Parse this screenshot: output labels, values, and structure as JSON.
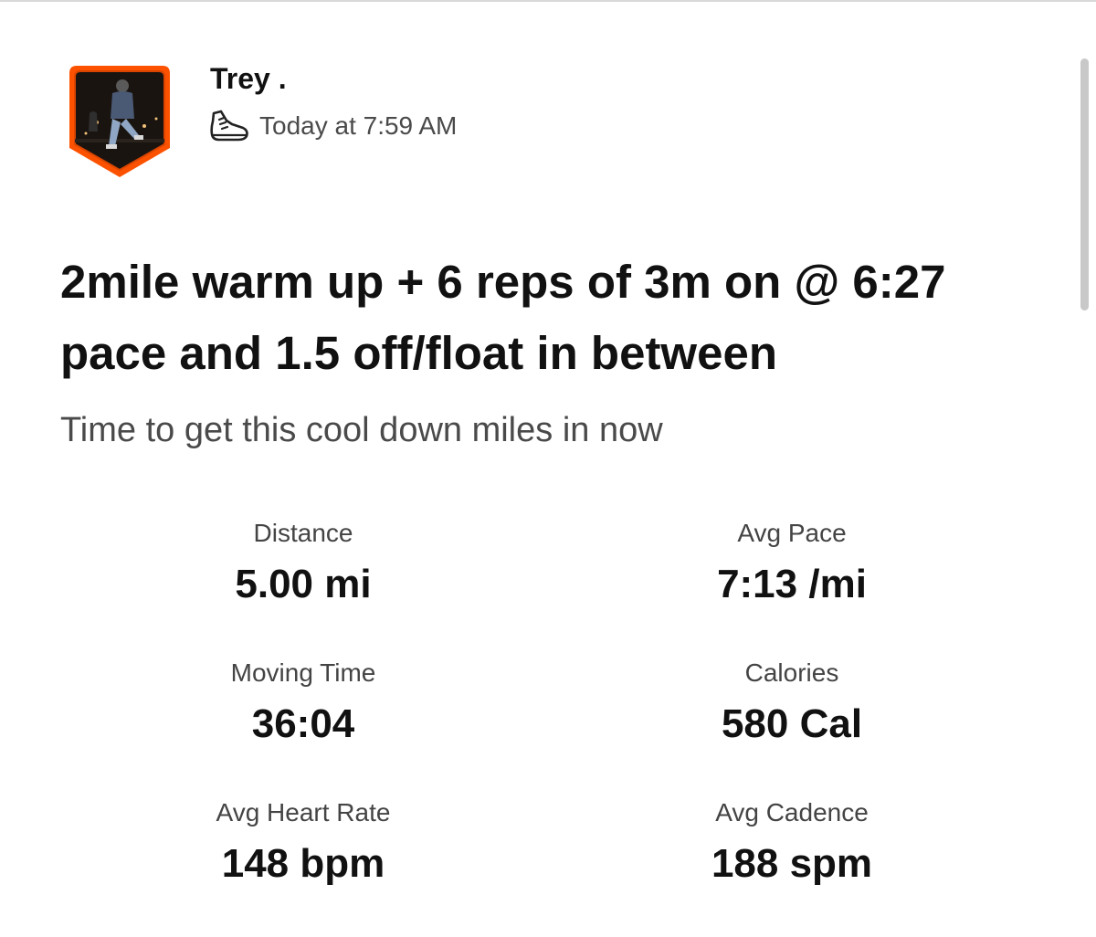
{
  "colors": {
    "accent": "#fc5200",
    "text_primary": "#111111",
    "text_secondary": "#4a4a4a",
    "background": "#ffffff"
  },
  "header": {
    "athlete_name": "Trey .",
    "activity_icon": "running-shoe-icon",
    "timestamp": "Today at 7:59 AM"
  },
  "activity": {
    "title": "2mile warm up + 6 reps of 3m on @ 6:27 pace and 1.5 off/float in between",
    "description": "Time to get this cool down miles in now"
  },
  "stats": {
    "distance": {
      "label": "Distance",
      "value": "5.00 mi"
    },
    "avg_pace": {
      "label": "Avg Pace",
      "value": "7:13 /mi"
    },
    "moving_time": {
      "label": "Moving Time",
      "value": "36:04"
    },
    "calories": {
      "label": "Calories",
      "value": "580 Cal"
    },
    "avg_heart_rate": {
      "label": "Avg Heart Rate",
      "value": "148 bpm"
    },
    "avg_cadence": {
      "label": "Avg Cadence",
      "value": "188 spm"
    }
  }
}
